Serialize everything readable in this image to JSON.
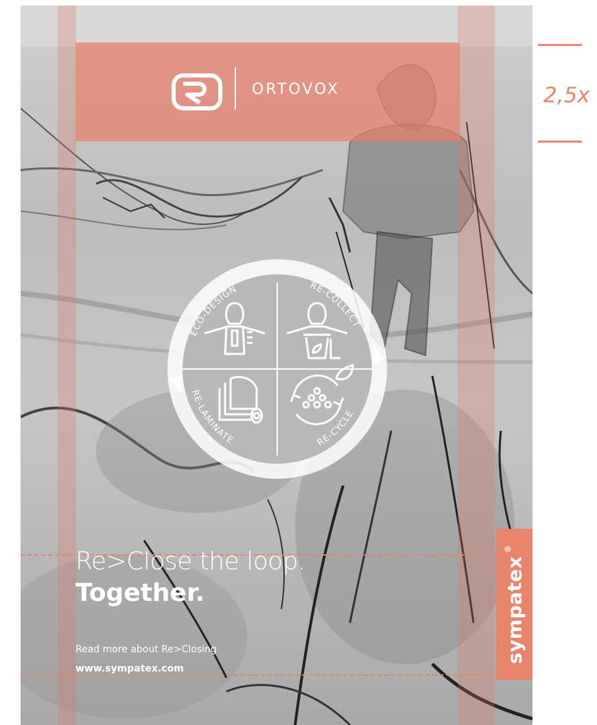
{
  "brand": {
    "name": "ORTOVOX",
    "accent_color": "#e8846c"
  },
  "annotation": {
    "clearance_label": "2,5x"
  },
  "cycle": {
    "segments": [
      {
        "label": "ECO-DESIGN"
      },
      {
        "label": "RE-COLLECT"
      },
      {
        "label": "RE-LAMINATE"
      },
      {
        "label": "RE-CYCLE"
      }
    ]
  },
  "headline": {
    "line1": "Re>Close the loop.",
    "line2": "Together."
  },
  "read_more": {
    "text": "Read more about Re>Closing",
    "url": "www.sympatex.com"
  },
  "partner": {
    "name": "sympatex",
    "registered_mark": "®"
  }
}
